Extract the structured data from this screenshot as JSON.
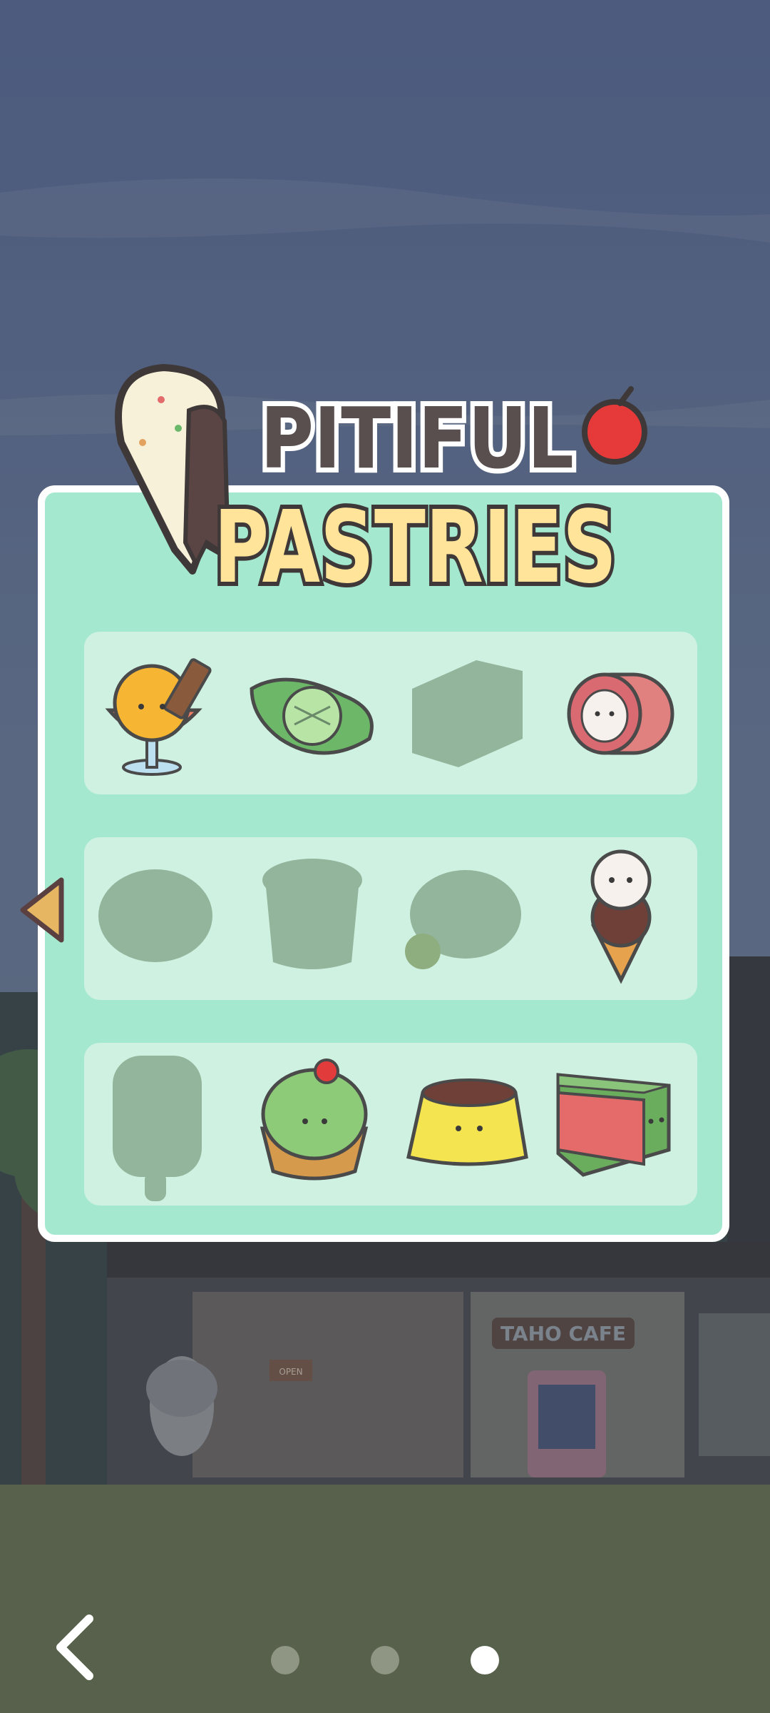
{
  "banner": {
    "line1": "PITIFUL",
    "line2": "PASTRIES"
  },
  "cafe_sign": "TAHO CAFE",
  "shop_sign": "OPEN",
  "items": [
    [
      {
        "name": "ice-cream-sundae",
        "unlocked": true
      },
      {
        "name": "mochi-leaf",
        "unlocked": true
      },
      {
        "name": "castella-block",
        "unlocked": false
      },
      {
        "name": "swiss-roll",
        "unlocked": true
      }
    ],
    [
      {
        "name": "bread-bun",
        "unlocked": false
      },
      {
        "name": "cupcake",
        "unlocked": false
      },
      {
        "name": "dumpling",
        "unlocked": false
      },
      {
        "name": "ice-cream-cone",
        "unlocked": true
      }
    ],
    [
      {
        "name": "popsicle",
        "unlocked": false
      },
      {
        "name": "matcha-tart",
        "unlocked": true
      },
      {
        "name": "pudding",
        "unlocked": true
      },
      {
        "name": "cake-slice",
        "unlocked": true
      }
    ]
  ],
  "pagination": {
    "count": 3,
    "active": 2
  },
  "colors": {
    "panel": "#a4e9cf",
    "row": "#cff1e1",
    "title_pastries": "#ffe49a",
    "title_pitiful": "#5a4f4f"
  }
}
